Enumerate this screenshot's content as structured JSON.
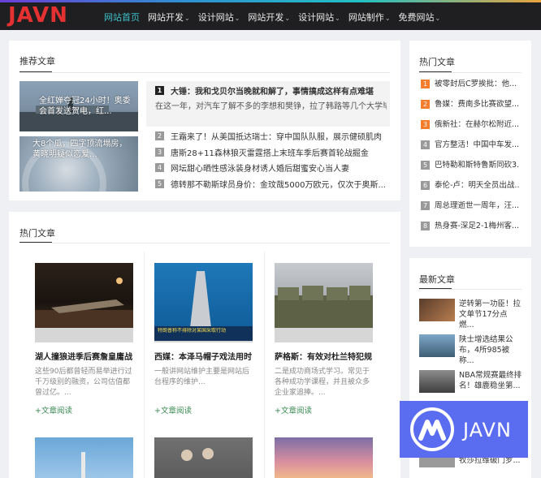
{
  "logo": "JAVN",
  "nav": [
    {
      "label": "网站首页",
      "active": true
    },
    {
      "label": "网站开发",
      "caret": true
    },
    {
      "label": "设计网站",
      "caret": true
    },
    {
      "label": "网站开发",
      "caret": true
    },
    {
      "label": "设计网站",
      "caret": true
    },
    {
      "label": "网站制作",
      "caret": true
    },
    {
      "label": "免费网站",
      "caret": true
    }
  ],
  "caret": "⌄",
  "recommended": {
    "title": "推荐文章",
    "slides": [
      {
        "caption": "全红婵夺冠24小时！奥委会首发送贺电，红..."
      },
      {
        "caption": "大8个瓜，四字顶流塌房，黄晓明疑似恋爱..."
      }
    ],
    "items": [
      {
        "num": "1",
        "title": "大锤：我和戈贝尔当晚就和解了，事情搞成这样有点难堪",
        "summary": "在这一年，对汽车了解不多的李想和樊铮，拉了韩路等几个大学毕业生开"
      },
      {
        "num": "2",
        "title": "王霜来了！从美国抵达瑞士：穿中国队队服，展示健硕肌肉"
      },
      {
        "num": "3",
        "title": "唐斯28+11森林狼灭雷霆搭上末班车季后赛首轮战掘金"
      },
      {
        "num": "4",
        "title": "网坛甜心晒性感泳装身材诱人婚后甜蜜安心当人妻"
      },
      {
        "num": "5",
        "title": "德转那不勒斯球员身价：金玟哉5000万欧元，仅次于奥斯..."
      }
    ]
  },
  "hot_main": {
    "title": "热门文章",
    "items": [
      {
        "title": "湖人撞狼进季后赛詹皇庸战...",
        "desc": "这些90后都曾轻而易举进行过千万级别的融资，公司估值都曾过亿。...",
        "more": "+文章阅读"
      },
      {
        "title": "西媒：本泽马帽子戏法用时...",
        "desc": "一般讲网站维护主要是网站后台程序的维护...",
        "more": "+文章阅读",
        "img_text": "特朗普称不排除对某国采取行动"
      },
      {
        "title": "萨格斯：有效对杜兰特犯规...",
        "desc": "二是成功商场式学习。常见于各种成功学课程，并且被众多企业家追捧。...",
        "more": "+文章阅读"
      }
    ]
  },
  "hot_side": {
    "title": "热门文章",
    "items": [
      {
        "num": "1",
        "text": "被零封后C罗挨批：他..."
      },
      {
        "num": "2",
        "text": "鲁媒：费南多比赛欲望..."
      },
      {
        "num": "3",
        "text": "俄新社：在赫尔松附近..."
      },
      {
        "num": "4",
        "text": "官方整活！中国中车发..."
      },
      {
        "num": "5",
        "text": "巴特勒和斯特鲁斯同砍3..."
      },
      {
        "num": "6",
        "text": "泰伦-卢：明天全员出战..."
      },
      {
        "num": "7",
        "text": "周总理逝世一周年，汪..."
      },
      {
        "num": "8",
        "text": "热身赛-深足2-1梅州客..."
      }
    ]
  },
  "latest": {
    "title": "最新文章",
    "items": [
      {
        "text": "逆转第一功臣！拉文单节17分点燃..."
      },
      {
        "text": "陕士增选结果公布，4所985被称..."
      },
      {
        "text": "NBA常规赛最终排名！雄鹿稳坐第..."
      },
      {
        "text": "牧莎拉维破门罗..."
      }
    ]
  },
  "ad": {
    "text": "JAVN"
  },
  "colors": {
    "accent": "#3ec0c9",
    "logo": "#e53131",
    "ad": "#5a6df0",
    "orange": "#f57c2b",
    "more": "#3a8a53"
  }
}
